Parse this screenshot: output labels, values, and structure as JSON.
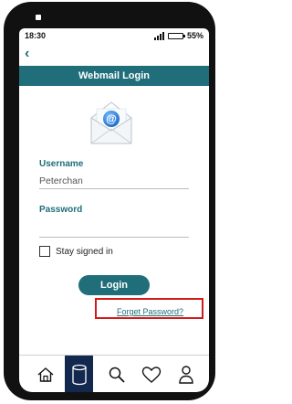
{
  "status_bar": {
    "time": "18:30",
    "battery": "55%"
  },
  "header": {
    "title": "Webmail Login"
  },
  "form": {
    "username_label": "Username",
    "username_value": "Peterchan",
    "password_label": "Password",
    "password_value": "",
    "stay_signed_in_label": "Stay signed in",
    "stay_signed_in_checked": false,
    "login_label": "Login",
    "forgot_password_label": "Forget Password?"
  },
  "icons": {
    "back": "chevron-left-icon",
    "mail": "email-envelope-icon",
    "tabs": [
      "home-icon",
      "database-icon",
      "search-icon",
      "heart-icon",
      "user-icon"
    ]
  },
  "active_tab": "database",
  "colors": {
    "accent": "#1f6e7a",
    "active_tab_bg": "#13284e",
    "highlight": "#d11a1a"
  }
}
